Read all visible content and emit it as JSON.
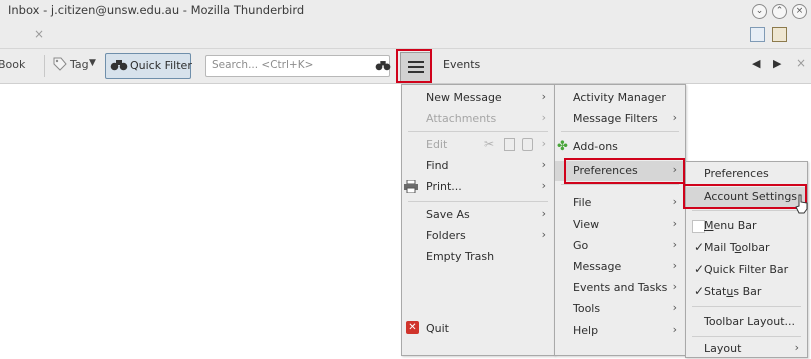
{
  "window": {
    "title": "Inbox - j.citizen@unsw.edu.au - Mozilla Thunderbird"
  },
  "tabbar": {
    "close_glyph": "×"
  },
  "toolbar": {
    "address_book_fragment": "Book",
    "tag_label": "Tag",
    "quick_filter_label": "Quick Filter",
    "search_placeholder": "Search... <Ctrl+K>",
    "events_label": "Events"
  },
  "main_menu": {
    "items": [
      {
        "label": "New Message",
        "enabled": true
      },
      {
        "label": "Attachments",
        "enabled": false
      },
      {
        "label": "Edit",
        "enabled": false
      },
      {
        "label": "Find",
        "enabled": true
      },
      {
        "label": "Print...",
        "enabled": true
      },
      {
        "label": "Save As",
        "enabled": true
      },
      {
        "label": "Folders",
        "enabled": true
      },
      {
        "label": "Empty Trash",
        "enabled": true
      },
      {
        "label": "Quit",
        "enabled": true
      }
    ]
  },
  "sub_menu": {
    "items": [
      {
        "label": "Activity Manager"
      },
      {
        "label": "Message Filters"
      },
      {
        "label": "Add-ons"
      },
      {
        "label": "Preferences",
        "highlighted": true
      },
      {
        "label": "File"
      },
      {
        "label": "View"
      },
      {
        "label": "Go"
      },
      {
        "label": "Message"
      },
      {
        "label": "Events and Tasks"
      },
      {
        "label": "Tools"
      },
      {
        "label": "Help"
      }
    ]
  },
  "prefs_menu": {
    "preferences": "Preferences",
    "account_settings": "Account Settings",
    "menu_bar": {
      "pre": "",
      "ul": "M",
      "post": "enu Bar",
      "checked": false
    },
    "mail_toolbar": {
      "pre": "Mail T",
      "ul": "o",
      "post": "olbar",
      "checked": true
    },
    "quick_filter_bar": {
      "pre": "Quick Filter Bar",
      "ul": "",
      "post": "",
      "checked": true
    },
    "status_bar": {
      "pre": "Stat",
      "ul": "u",
      "post": "s Bar",
      "checked": true
    },
    "toolbar_layout": "Toolbar Layout...",
    "layout": "Layout"
  },
  "colors": {
    "highlight_box": "#d0021b",
    "menu_bg": "#ededed",
    "quick_filter_bg": "#d7e2ec"
  }
}
